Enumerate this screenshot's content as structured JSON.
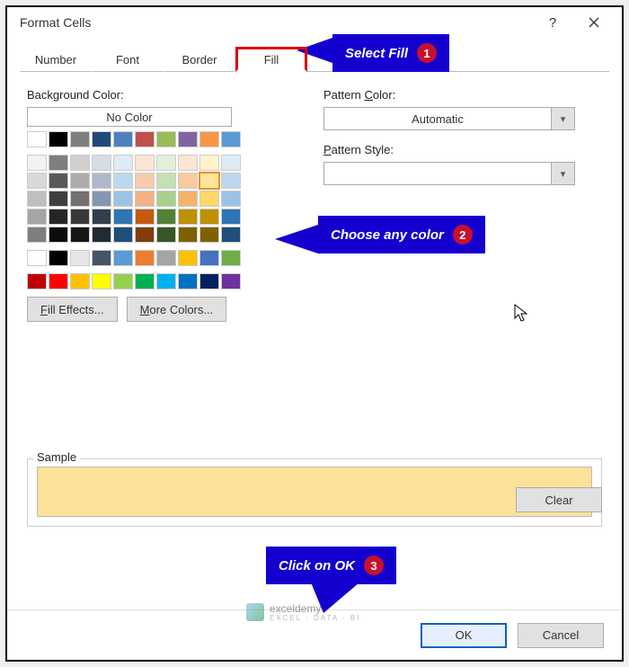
{
  "title": "Format Cells",
  "tabs": {
    "number": "Number",
    "font": "Font",
    "border": "Border",
    "fill": "Fill"
  },
  "bg_label": "Background Color:",
  "no_color": "No Color",
  "pattern_color_label": "Pattern Color:",
  "pattern_color_value": "Automatic",
  "pattern_style_label": "Pattern Style:",
  "fill_effects": "Fill Effects...",
  "more_colors": "More Colors...",
  "sample_label": "Sample",
  "clear": "Clear",
  "ok": "OK",
  "cancel": "Cancel",
  "callout1": "Select Fill",
  "callout2": "Choose any color",
  "callout3": "Click on OK",
  "colors_row1": [
    "#ffffff",
    "#000000",
    "#7f7f7f",
    "#1f497d",
    "#4f81bd",
    "#c0504d",
    "#9bbb59",
    "#8064a2",
    "#f79646",
    "#599ad3"
  ],
  "colors_theme": [
    [
      "#f2f2f2",
      "#7f7f7f",
      "#d0cece",
      "#d5dce4",
      "#deeaf6",
      "#fbe5d5",
      "#e2efd9",
      "#fce5d5",
      "#fff2cc",
      "#deebf6"
    ],
    [
      "#d8d8d8",
      "#595959",
      "#aeabab",
      "#adb9ca",
      "#bdd7ee",
      "#f7cbac",
      "#c5e0b3",
      "#f9cb9c",
      "#fee599",
      "#bdd7ee"
    ],
    [
      "#bfbfbf",
      "#3f3f3f",
      "#757070",
      "#8496b0",
      "#9cc3e5",
      "#f4b183",
      "#a8d08d",
      "#f6b26b",
      "#fcd966",
      "#9cc3e5"
    ],
    [
      "#a5a5a5",
      "#262626",
      "#3a3838",
      "#323f4f",
      "#2e75b5",
      "#c55a11",
      "#538135",
      "#bf9000",
      "#bf9000",
      "#2e75b5"
    ],
    [
      "#7f7f7f",
      "#0c0c0c",
      "#171616",
      "#222a35",
      "#1e4e79",
      "#833c0b",
      "#375623",
      "#7f6000",
      "#806000",
      "#1e4e79"
    ]
  ],
  "colors_std": [
    "#c00000",
    "#ff0000",
    "#ffc000",
    "#ffff00",
    "#92d050",
    "#00b050",
    "#00b0f0",
    "#0070c0",
    "#002060",
    "#7030a0"
  ],
  "colors_extra": [
    "#ffffff",
    "#000000",
    "#e7e6e6",
    "#44546a",
    "#5b9bd5",
    "#ed7d31",
    "#a5a5a5",
    "#ffc000",
    "#4472c4",
    "#70ad47"
  ],
  "selected_theme": {
    "row": 1,
    "col": 8
  },
  "watermark": {
    "name": "exceldemy",
    "sub": "EXCEL · DATA · BI"
  }
}
